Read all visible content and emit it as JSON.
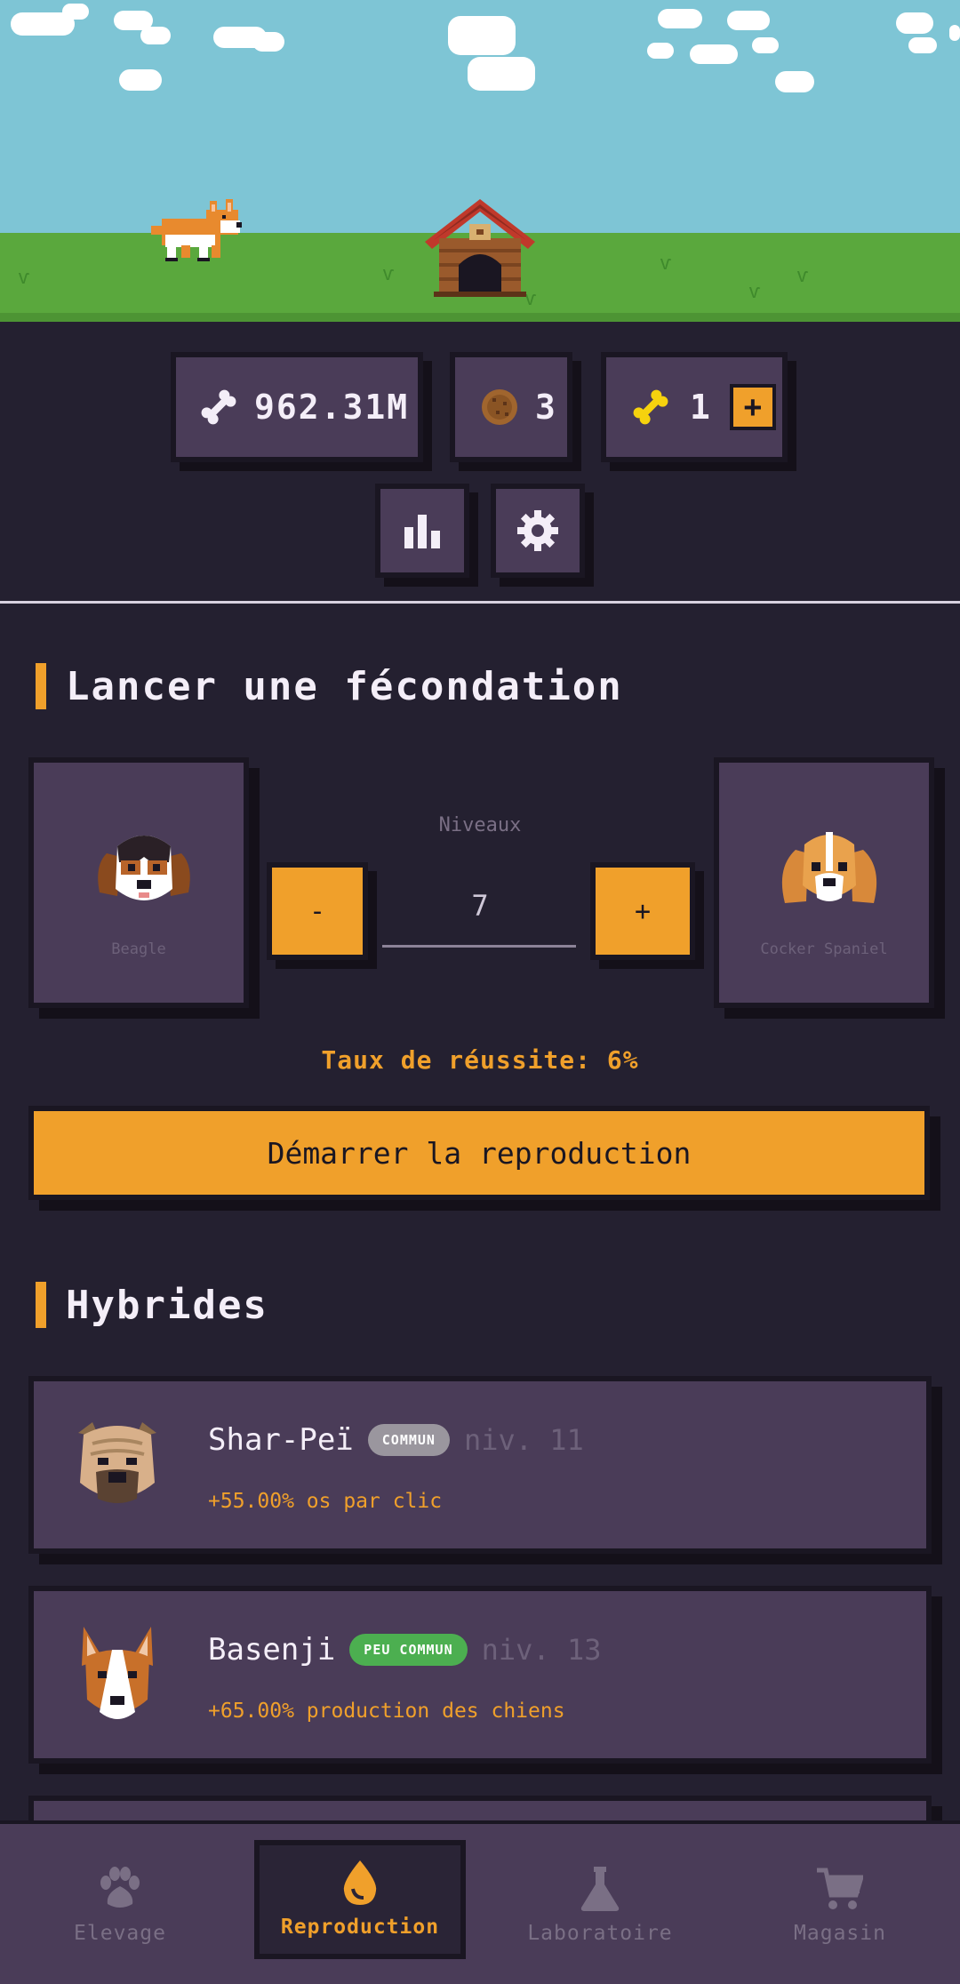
{
  "stats": {
    "bones": "962.31M",
    "cookies": "3",
    "golden_bones": "1",
    "add_label": "+"
  },
  "breeding": {
    "title": "Lancer une fécondation",
    "left_dog": "Beagle",
    "right_dog": "Cocker Spaniel",
    "levels_label": "Niveaux",
    "levels_value": "7",
    "minus_label": "-",
    "plus_label": "+",
    "success_rate": "Taux de réussite: 6%",
    "start_label": "Démarrer la reproduction"
  },
  "hybrids": {
    "title": "Hybrides",
    "items": [
      {
        "name": "Shar-Peï",
        "rarity": "COMMUN",
        "rarity_color": "#9a969e",
        "level": "niv. 11",
        "bonus": "+55.00% os par clic"
      },
      {
        "name": "Basenji",
        "rarity": "PEU COMMUN",
        "rarity_color": "#4caf50",
        "level": "niv. 13",
        "bonus": "+65.00% production des chiens"
      }
    ]
  },
  "nav": {
    "items": [
      {
        "label": "Elevage",
        "icon": "paw-icon"
      },
      {
        "label": "Reproduction",
        "icon": "drop-icon"
      },
      {
        "label": "Laboratoire",
        "icon": "flask-icon"
      },
      {
        "label": "Magasin",
        "icon": "cart-icon"
      }
    ],
    "active": "Reproduction"
  },
  "colors": {
    "accent": "#f0a02b",
    "background": "#242030",
    "card": "#4a3c58",
    "sky": "#7ec5d5",
    "grass": "#5aa83d"
  }
}
